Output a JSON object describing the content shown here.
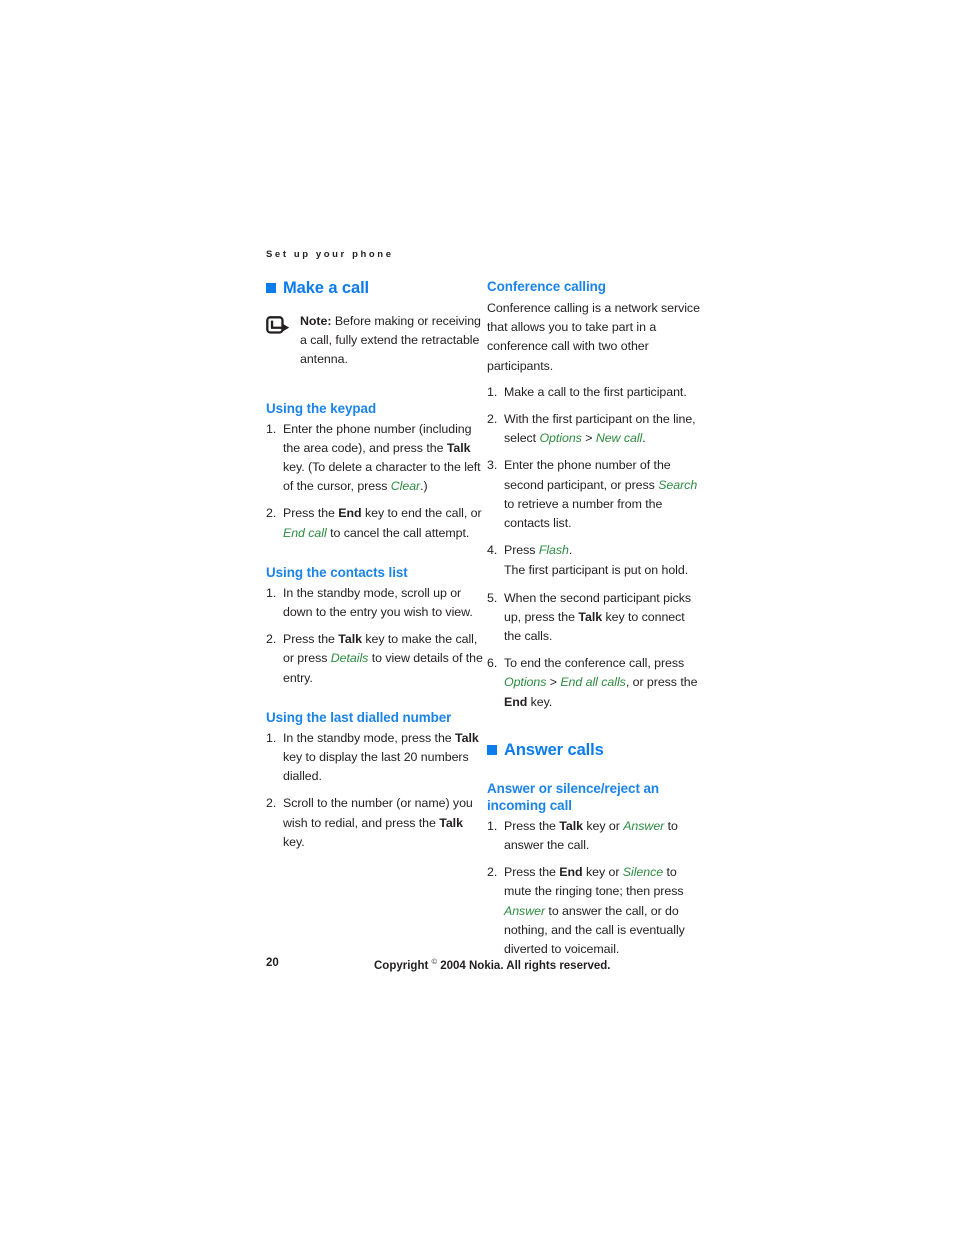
{
  "page": {
    "running_header": "Set up your phone",
    "folio": "20",
    "copyright_pre": "Copyright ",
    "copyright_symbol": "©",
    "copyright_post": " 2004 Nokia. All rights reserved."
  },
  "colors": {
    "heading_blue": "#0b7cec",
    "subheading_blue": "#1b84e8",
    "ui_command_green": "#2d8c40",
    "body_text": "#231f20"
  },
  "left_column": {
    "section_title": "Make a call",
    "note": {
      "icon": "note-arrow-icon",
      "label": "Note:",
      "text": " Before making or receiving a call, fully extend the retractable antenna."
    },
    "subsections": [
      {
        "title": "Using the keypad",
        "steps": [
          {
            "num": "1.",
            "parts": [
              {
                "type": "plain",
                "text": "Enter the phone number (including the area code), and press the "
              },
              {
                "type": "bold",
                "text": "Talk"
              },
              {
                "type": "plain",
                "text": " key. (To delete a character to the left of the cursor, press "
              },
              {
                "type": "ui",
                "text": "Clear"
              },
              {
                "type": "plain",
                "text": ".)"
              }
            ]
          },
          {
            "num": "2.",
            "parts": [
              {
                "type": "plain",
                "text": "Press the "
              },
              {
                "type": "bold",
                "text": "End"
              },
              {
                "type": "plain",
                "text": " key to end the call, or "
              },
              {
                "type": "ui",
                "text": "End call"
              },
              {
                "type": "plain",
                "text": " to cancel the call attempt."
              }
            ]
          }
        ]
      },
      {
        "title": "Using the contacts list",
        "steps": [
          {
            "num": "1.",
            "parts": [
              {
                "type": "plain",
                "text": "In the standby mode, scroll up or down to the entry you wish to view."
              }
            ]
          },
          {
            "num": "2.",
            "parts": [
              {
                "type": "plain",
                "text": "Press the "
              },
              {
                "type": "bold",
                "text": "Talk"
              },
              {
                "type": "plain",
                "text": " key to make the call, or press "
              },
              {
                "type": "ui",
                "text": "Details"
              },
              {
                "type": "plain",
                "text": " to view details of the entry."
              }
            ]
          }
        ]
      },
      {
        "title": "Using the last dialled number",
        "steps": [
          {
            "num": "1.",
            "parts": [
              {
                "type": "plain",
                "text": "In the standby mode, press the "
              },
              {
                "type": "bold",
                "text": "Talk"
              },
              {
                "type": "plain",
                "text": " key to display the last 20 numbers dialled."
              }
            ]
          },
          {
            "num": "2.",
            "parts": [
              {
                "type": "plain",
                "text": "Scroll to the number (or name) you wish to redial, and press the "
              },
              {
                "type": "bold",
                "text": "Talk"
              },
              {
                "type": "plain",
                "text": " key."
              }
            ]
          }
        ]
      }
    ]
  },
  "right_column": {
    "conference": {
      "title": "Conference calling",
      "intro": "Conference calling is a network service that allows you to take part in a conference call with two other participants.",
      "steps": [
        {
          "num": "1.",
          "parts": [
            {
              "type": "plain",
              "text": "Make a call to the first participant."
            }
          ]
        },
        {
          "num": "2.",
          "parts": [
            {
              "type": "plain",
              "text": "With the first participant on the line, select "
            },
            {
              "type": "ui",
              "text": "Options"
            },
            {
              "type": "plain",
              "text": " > "
            },
            {
              "type": "ui",
              "text": "New call"
            },
            {
              "type": "plain",
              "text": "."
            }
          ]
        },
        {
          "num": "3.",
          "parts": [
            {
              "type": "plain",
              "text": "Enter the phone number of the second participant, or press "
            },
            {
              "type": "ui",
              "text": "Search"
            },
            {
              "type": "plain",
              "text": " to retrieve a number from the contacts list."
            }
          ]
        },
        {
          "num": "4.",
          "parts": [
            {
              "type": "plain",
              "text": "Press "
            },
            {
              "type": "ui",
              "text": "Flash"
            },
            {
              "type": "plain",
              "text": "."
            }
          ],
          "substep": "The first participant is put on hold."
        },
        {
          "num": "5.",
          "parts": [
            {
              "type": "plain",
              "text": "When the second participant picks up, press the "
            },
            {
              "type": "bold",
              "text": "Talk"
            },
            {
              "type": "plain",
              "text": " key to connect the calls."
            }
          ]
        },
        {
          "num": "6.",
          "parts": [
            {
              "type": "plain",
              "text": "To end the conference call, press "
            },
            {
              "type": "ui",
              "text": "Options"
            },
            {
              "type": "plain",
              "text": " > "
            },
            {
              "type": "ui",
              "text": "End all calls"
            },
            {
              "type": "plain",
              "text": ", or press the "
            },
            {
              "type": "bold",
              "text": "End"
            },
            {
              "type": "plain",
              "text": " key."
            }
          ]
        }
      ]
    },
    "answer_calls": {
      "section_title": "Answer calls",
      "subsection_title": "Answer or silence/reject an incoming call",
      "steps": [
        {
          "num": "1.",
          "parts": [
            {
              "type": "plain",
              "text": "Press the "
            },
            {
              "type": "bold",
              "text": "Talk"
            },
            {
              "type": "plain",
              "text": " key or "
            },
            {
              "type": "ui",
              "text": "Answer"
            },
            {
              "type": "plain",
              "text": " to answer the call."
            }
          ]
        },
        {
          "num": "2.",
          "parts": [
            {
              "type": "plain",
              "text": "Press the "
            },
            {
              "type": "bold",
              "text": "End"
            },
            {
              "type": "plain",
              "text": " key or "
            },
            {
              "type": "ui",
              "text": "Silence"
            },
            {
              "type": "plain",
              "text": " to mute the ringing tone; then press "
            },
            {
              "type": "ui",
              "text": "Answer"
            },
            {
              "type": "plain",
              "text": " to answer the call, or do nothing, and the call is eventually diverted to voicemail."
            }
          ]
        }
      ]
    }
  }
}
